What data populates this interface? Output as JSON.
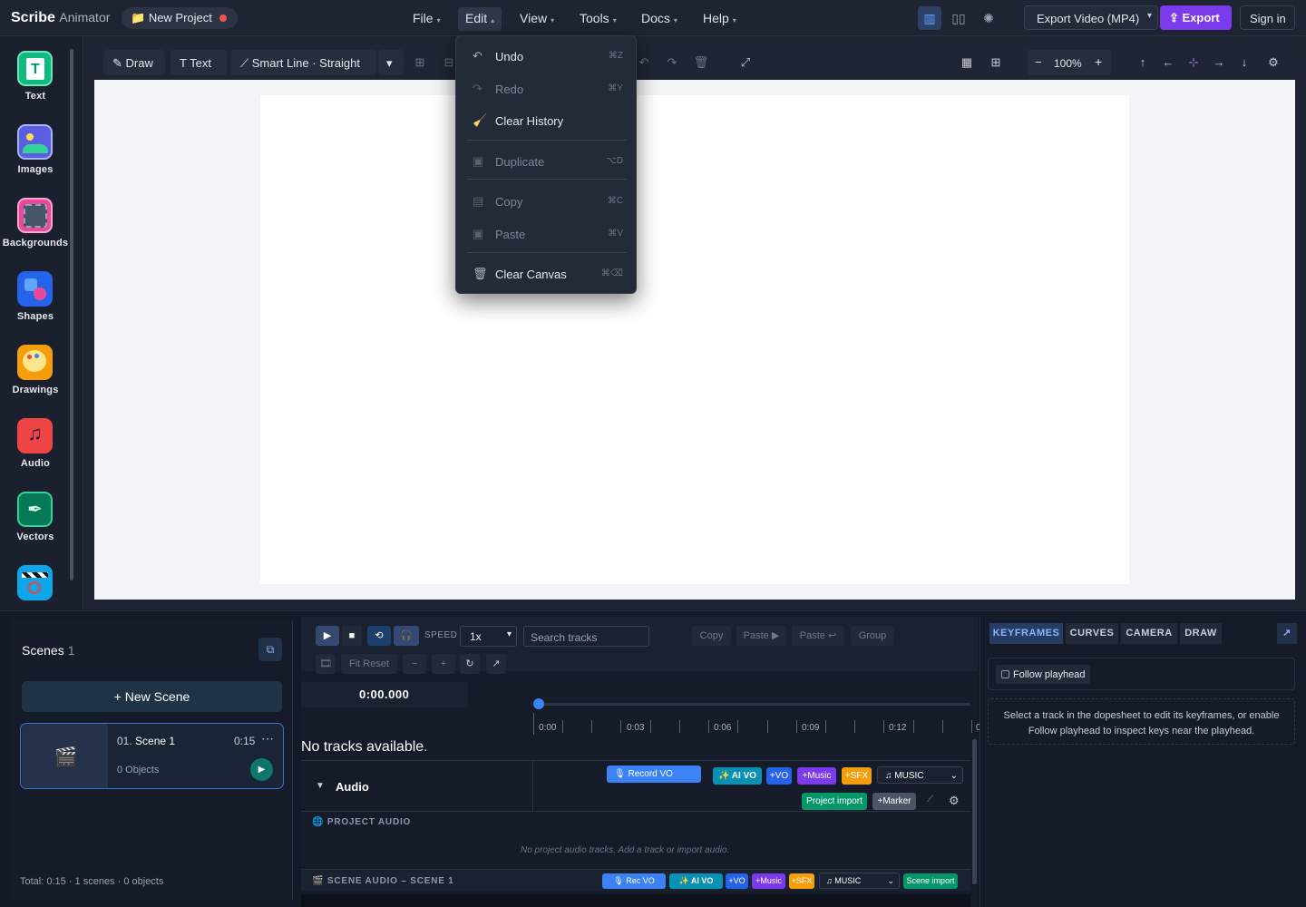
{
  "app": {
    "brand_bold": "Scribe",
    "brand_light": "Animator",
    "project_name": "New Project"
  },
  "menubar": {
    "items": [
      {
        "label": "File"
      },
      {
        "label": "Edit"
      },
      {
        "label": "View"
      },
      {
        "label": "Tools"
      },
      {
        "label": "Docs"
      },
      {
        "label": "Help"
      }
    ]
  },
  "topright": {
    "export_format": "Export Video (MP4)",
    "export_label": "Export",
    "signin_label": "Sign in"
  },
  "sidebar": {
    "items": [
      {
        "label": "Text",
        "icon": "text-tool-icon"
      },
      {
        "label": "Images",
        "icon": "image-icon"
      },
      {
        "label": "Backgrounds",
        "icon": "backgrounds-icon"
      },
      {
        "label": "Shapes",
        "icon": "shapes-icon"
      },
      {
        "label": "Drawings",
        "icon": "palette-icon"
      },
      {
        "label": "Audio",
        "icon": "music-note-icon"
      },
      {
        "label": "Vectors",
        "icon": "pen-vector-icon"
      }
    ]
  },
  "toolbar": {
    "draw_label": "Draw",
    "text_label": "Text",
    "smartline_label": "Smart Line · Straight",
    "zoom": "100%"
  },
  "edit_menu": {
    "items": [
      {
        "label": "Undo",
        "shortcut": "⌘Z",
        "icon": "undo-icon",
        "enabled": true
      },
      {
        "label": "Redo",
        "shortcut": "⌘Y",
        "icon": "redo-icon",
        "enabled": false
      },
      {
        "label": "Clear History",
        "shortcut": "",
        "icon": "broom-icon",
        "enabled": true
      },
      {
        "label": "Duplicate",
        "shortcut": "⌥D",
        "icon": "clipboard-icon",
        "enabled": false
      },
      {
        "label": "Copy",
        "shortcut": "⌘C",
        "icon": "document-icon",
        "enabled": false
      },
      {
        "label": "Paste",
        "shortcut": "⌘V",
        "icon": "clipboard-icon",
        "enabled": false
      },
      {
        "label": "Clear Canvas",
        "shortcut": "⌘⌫",
        "icon": "trash-icon",
        "enabled": true
      }
    ]
  },
  "scenes": {
    "title": "Scenes",
    "count": "1",
    "new_scene_label": "+ New Scene",
    "list": [
      {
        "index": "01.",
        "name": "Scene 1",
        "duration": "0:15",
        "objects": "0 Objects"
      }
    ],
    "total": "Total: 0:15 · 1 scenes · 0 objects"
  },
  "timeline": {
    "speed_label": "SPEED",
    "speed_value": "1x",
    "search_placeholder": "Search tracks",
    "copy_label": "Copy",
    "paste_label": "Paste ▶",
    "paste2_label": "Paste ↩",
    "group_label": "Group",
    "fit_reset_label": "Fit Reset",
    "timecode": "0:00.000",
    "ruler_labels": [
      "0:00",
      "0:03",
      "0:06",
      "0:09",
      "0:12",
      "0"
    ],
    "no_tracks": "No tracks available.",
    "audio_label": "Audio",
    "audio_chips": {
      "record_vo": "🎙 Record VO",
      "ai_vo": "✨ AI VO",
      "vo": "+VO",
      "music": "+Music",
      "sfx": "+SFX",
      "music_select": "♫ MUSIC",
      "project_import": "Project import",
      "marker": "+Marker"
    },
    "project_audio_label": "PROJECT AUDIO",
    "project_audio_empty": "No project audio tracks. Add a track or import audio.",
    "scene_audio_label": "SCENE AUDIO – SCENE 1",
    "scene_chips": {
      "rec_vo": "🎙 Rec VO",
      "ai_vo": "✨ AI VO",
      "vo": "+VO",
      "music": "+Music",
      "sfx": "+SFX",
      "music_select": "♫ MUSIC",
      "scene_import": "Scene import"
    }
  },
  "right_panel": {
    "tabs": [
      "KEYFRAMES",
      "CURVES",
      "CAMERA",
      "DRAW"
    ],
    "follow_label": "Follow playhead",
    "info": "Select a track in the dopesheet to edit its keyframes, or enable Follow playhead to inspect keys near the playhead."
  },
  "colors": {
    "accent": "#7c3aed",
    "selection": "#3b82f6",
    "record": "#ef5350"
  }
}
